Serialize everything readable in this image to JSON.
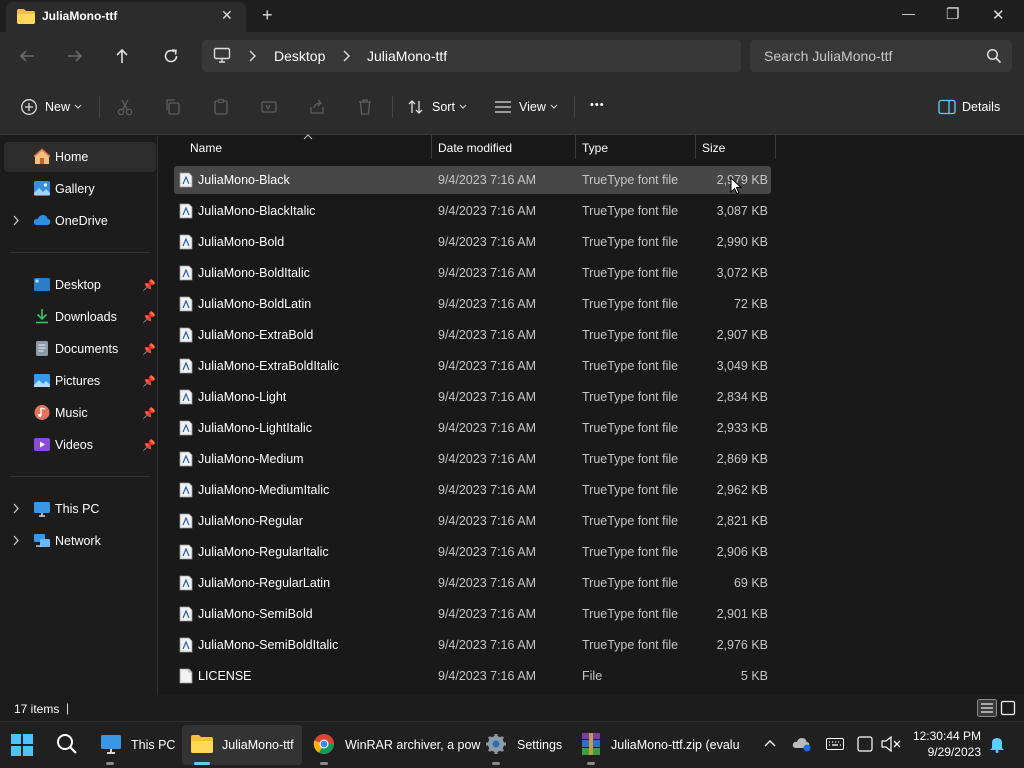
{
  "window": {
    "tab_title": "JuliaMono-ttf",
    "new_tab": "+",
    "minimize": "—",
    "maximize": "❐",
    "close": "✕"
  },
  "address": {
    "crumbs": [
      "Desktop",
      "JuliaMono-ttf"
    ],
    "search_placeholder": "Search JuliaMono-ttf"
  },
  "toolbar": {
    "new_label": "New",
    "sort_label": "Sort",
    "view_label": "View",
    "more_label": "•••",
    "details_label": "Details"
  },
  "sidebar": {
    "home": "Home",
    "gallery": "Gallery",
    "onedrive": "OneDrive",
    "quick": [
      "Desktop",
      "Downloads",
      "Documents",
      "Pictures",
      "Music",
      "Videos"
    ],
    "this_pc": "This PC",
    "network": "Network"
  },
  "columns": {
    "name": "Name",
    "date": "Date modified",
    "type": "Type",
    "size": "Size"
  },
  "files": [
    {
      "name": "JuliaMono-Black",
      "date": "9/4/2023 7:16 AM",
      "type": "TrueType font file",
      "size": "2,979 KB"
    },
    {
      "name": "JuliaMono-BlackItalic",
      "date": "9/4/2023 7:16 AM",
      "type": "TrueType font file",
      "size": "3,087 KB"
    },
    {
      "name": "JuliaMono-Bold",
      "date": "9/4/2023 7:16 AM",
      "type": "TrueType font file",
      "size": "2,990 KB"
    },
    {
      "name": "JuliaMono-BoldItalic",
      "date": "9/4/2023 7:16 AM",
      "type": "TrueType font file",
      "size": "3,072 KB"
    },
    {
      "name": "JuliaMono-BoldLatin",
      "date": "9/4/2023 7:16 AM",
      "type": "TrueType font file",
      "size": "72 KB"
    },
    {
      "name": "JuliaMono-ExtraBold",
      "date": "9/4/2023 7:16 AM",
      "type": "TrueType font file",
      "size": "2,907 KB"
    },
    {
      "name": "JuliaMono-ExtraBoldItalic",
      "date": "9/4/2023 7:16 AM",
      "type": "TrueType font file",
      "size": "3,049 KB"
    },
    {
      "name": "JuliaMono-Light",
      "date": "9/4/2023 7:16 AM",
      "type": "TrueType font file",
      "size": "2,834 KB"
    },
    {
      "name": "JuliaMono-LightItalic",
      "date": "9/4/2023 7:16 AM",
      "type": "TrueType font file",
      "size": "2,933 KB"
    },
    {
      "name": "JuliaMono-Medium",
      "date": "9/4/2023 7:16 AM",
      "type": "TrueType font file",
      "size": "2,869 KB"
    },
    {
      "name": "JuliaMono-MediumItalic",
      "date": "9/4/2023 7:16 AM",
      "type": "TrueType font file",
      "size": "2,962 KB"
    },
    {
      "name": "JuliaMono-Regular",
      "date": "9/4/2023 7:16 AM",
      "type": "TrueType font file",
      "size": "2,821 KB"
    },
    {
      "name": "JuliaMono-RegularItalic",
      "date": "9/4/2023 7:16 AM",
      "type": "TrueType font file",
      "size": "2,906 KB"
    },
    {
      "name": "JuliaMono-RegularLatin",
      "date": "9/4/2023 7:16 AM",
      "type": "TrueType font file",
      "size": "69 KB"
    },
    {
      "name": "JuliaMono-SemiBold",
      "date": "9/4/2023 7:16 AM",
      "type": "TrueType font file",
      "size": "2,901 KB"
    },
    {
      "name": "JuliaMono-SemiBoldItalic",
      "date": "9/4/2023 7:16 AM",
      "type": "TrueType font file",
      "size": "2,976 KB"
    },
    {
      "name": "LICENSE",
      "date": "9/4/2023 7:16 AM",
      "type": "File",
      "size": "5 KB"
    }
  ],
  "status": {
    "item_count": "17 items",
    "separator": "|"
  },
  "taskbar": {
    "apps": [
      {
        "label": "This PC",
        "icon": "this-pc-icon"
      },
      {
        "label": "JuliaMono-ttf",
        "icon": "folder-icon"
      },
      {
        "label": "WinRAR archiver, a pow",
        "icon": "chrome-icon"
      },
      {
        "label": "Settings",
        "icon": "settings-gear-icon"
      },
      {
        "label": "JuliaMono-ttf.zip (evalu",
        "icon": "winrar-icon"
      }
    ],
    "time": "12:30:44 PM",
    "date": "9/29/2023"
  },
  "colors": {
    "accent": "#60cdff",
    "folder": "#f4c430",
    "selected_row": "#474747"
  }
}
